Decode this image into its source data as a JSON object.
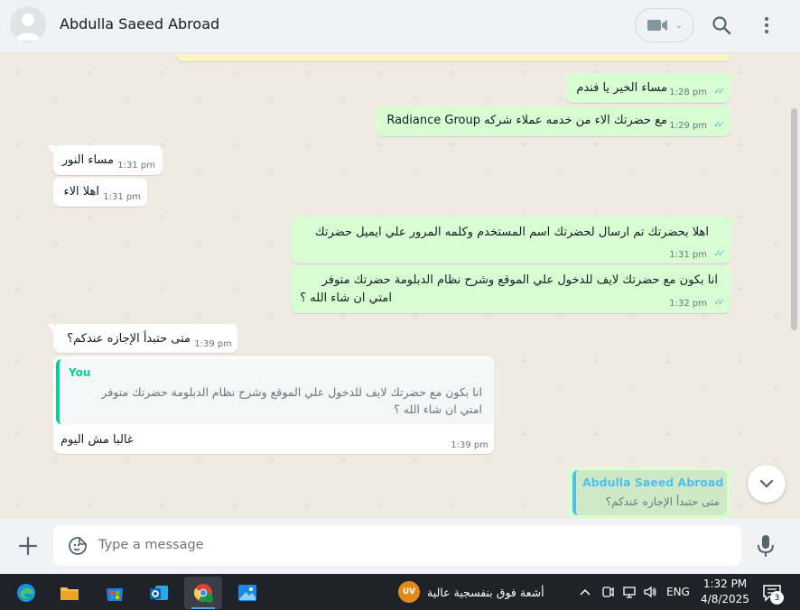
{
  "header": {
    "contact_name": "Abdulla Saeed Abroad",
    "video_chevron": "⌄"
  },
  "messages": [
    {
      "dir": "out",
      "text": "مساء الخير يا فندم",
      "time": "1:28 pm"
    },
    {
      "dir": "out",
      "text": "مع حضرتك الاء من خدمه عملاء شركه Radiance Group",
      "time": "1:29 pm"
    },
    {
      "dir": "in",
      "text": "مساء النور",
      "time": "1:31 pm"
    },
    {
      "dir": "in",
      "text": "اهلا الاء",
      "time": "1:31 pm"
    },
    {
      "dir": "out",
      "text": "اهلا بحضرتك تم ارسال لحضرتك اسم المستخدم وكلمه المرور علي ايميل حضرتك",
      "time": "1:31 pm"
    },
    {
      "dir": "out",
      "text_line1": "انا بكون مع حضرتك لايف للدخول علي الموقع وشرح نظام الدبلومة حضرتك متوفر",
      "text_line2": "امتي ان شاء الله ؟",
      "time": "1:32 pm"
    },
    {
      "dir": "in",
      "text": "متى حتبدأ الإجازه عندكم؟",
      "time": "1:39 pm"
    },
    {
      "dir": "in",
      "quote_author": "You",
      "quote_line1": "انا بكون مع حضرتك لايف للدخول علي الموقع وشرح نظام الدبلومة حضرتك متوفر",
      "quote_line2": "امتي ان شاء الله ؟",
      "text": "غالبا مش اليوم",
      "time": "1:39 pm"
    },
    {
      "dir": "out",
      "quote_author": "Abdulla Saeed Abroad",
      "quote_line1": "متى حتبدأ الإجازه عندكم؟"
    }
  ],
  "composer": {
    "placeholder": "Type a message"
  },
  "taskbar": {
    "apps": [
      "edge-icon",
      "file-explorer-icon",
      "store-icon",
      "outlook-icon",
      "chrome-icon",
      "photos-icon"
    ],
    "weather_badge": "UV",
    "weather_text": "أشعة فوق بنفسجية عالية",
    "language": "ENG",
    "time": "1:32 PM",
    "date": "4/8/2025",
    "notification_count": "3"
  },
  "colors": {
    "outgoing_bubble": "#d9fdd3",
    "incoming_bubble": "#ffffff",
    "read_ticks": "#53bdeb",
    "quote_you": "#06cf9c",
    "taskbar": "#1f2229"
  }
}
